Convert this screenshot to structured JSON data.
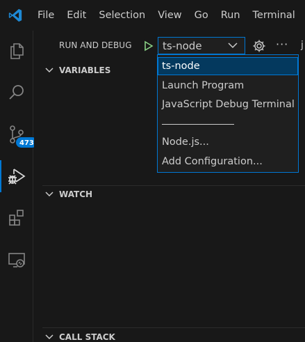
{
  "menu": {
    "items": [
      "File",
      "Edit",
      "Selection",
      "View",
      "Go",
      "Run",
      "Terminal"
    ]
  },
  "activity": {
    "scm_badge": "473",
    "icons": [
      "explorer-icon",
      "search-icon",
      "source-control-icon",
      "run-debug-icon",
      "extensions-icon",
      "remote-explorer-icon"
    ]
  },
  "sidebar": {
    "title": "RUN AND DEBUG",
    "config_value": "ts-node",
    "cut_text": "j",
    "sections": {
      "variables": "VARIABLES",
      "watch": "WATCH",
      "call_stack": "CALL STACK"
    }
  },
  "dropdown": {
    "options": [
      "ts-node",
      "Launch Program",
      "JavaScript Debug Terminal",
      "Node.js...",
      "Add Configuration..."
    ],
    "selected": "ts-node"
  },
  "colors": {
    "accent": "#0078d4",
    "background": "#181818",
    "run_green": "#89d185",
    "selected_bg": "#04395e"
  }
}
